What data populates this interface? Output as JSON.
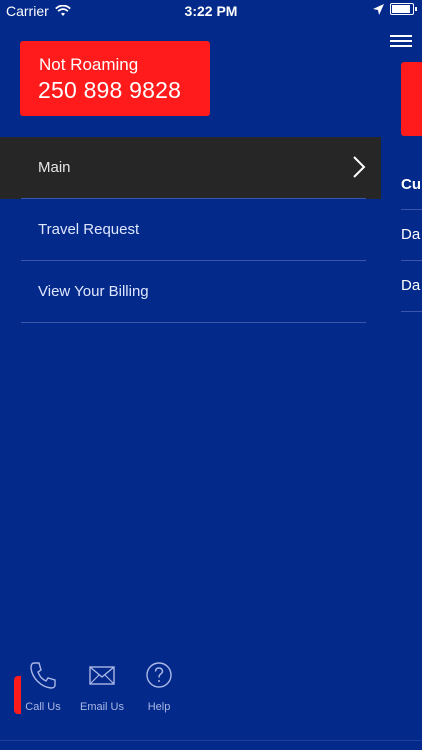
{
  "status_bar": {
    "carrier": "Carrier",
    "time": "3:22 PM"
  },
  "roaming": {
    "status": "Not Roaming",
    "number": "250 898 9828"
  },
  "menu": {
    "items": [
      {
        "label": "Main",
        "active": true
      },
      {
        "label": "Travel Request"
      },
      {
        "label": "View Your Billing"
      }
    ]
  },
  "bottom_bar": {
    "call": "Call Us",
    "email": "Email Us",
    "help": "Help"
  },
  "right_panel": {
    "row1": "Cu",
    "row2": "Da",
    "row3": "Da"
  },
  "colors": {
    "background": "#032a8a",
    "accent": "#ff1b1b",
    "active_row": "#262626"
  }
}
